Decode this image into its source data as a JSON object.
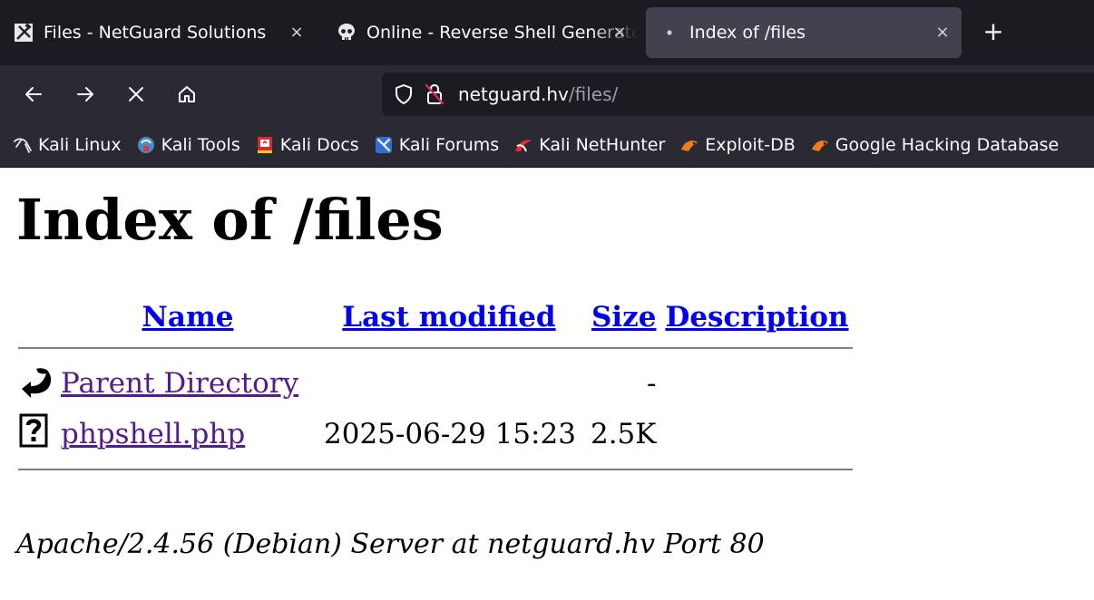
{
  "browser": {
    "tabs": [
      {
        "title": "Files - NetGuard Solutions",
        "icon": "tools-icon",
        "active": false
      },
      {
        "title": "Online - Reverse Shell Generator",
        "icon": "skull-icon",
        "active": false
      },
      {
        "title": "Index of /files",
        "icon": "dot-icon",
        "active": true
      }
    ],
    "tab_close_glyph": "×",
    "new_tab_glyph": "+",
    "url": {
      "host": "netguard.hv",
      "path": "/files/"
    },
    "bookmarks": [
      {
        "label": "Kali Linux",
        "icon": "kali-dragon-icon"
      },
      {
        "label": "Kali Tools",
        "icon": "kali-tools-icon"
      },
      {
        "label": "Kali Docs",
        "icon": "kali-docs-icon"
      },
      {
        "label": "Kali Forums",
        "icon": "kali-forums-icon"
      },
      {
        "label": "Kali NetHunter",
        "icon": "nethunter-icon"
      },
      {
        "label": "Exploit-DB",
        "icon": "exploit-db-icon"
      },
      {
        "label": "Google Hacking Database",
        "icon": "ghdb-icon"
      }
    ],
    "colors": {
      "tabstrip": "#1c1b22",
      "toolbar": "#2b2a33",
      "active_tab": "#42414d"
    }
  },
  "page": {
    "title": "Index of /files",
    "columns": {
      "name": "Name",
      "modified": "Last modified",
      "size": "Size",
      "description": "Description"
    },
    "rows": [
      {
        "name": "Parent Directory",
        "modified": "",
        "size": "-",
        "description": "",
        "icon": "back-arrow-icon"
      },
      {
        "name": "phpshell.php",
        "modified": "2025-06-29 15:23",
        "size": "2.5K",
        "description": "",
        "icon": "unknown-file-icon"
      }
    ],
    "footer": "Apache/2.4.56 (Debian) Server at netguard.hv Port 80"
  }
}
